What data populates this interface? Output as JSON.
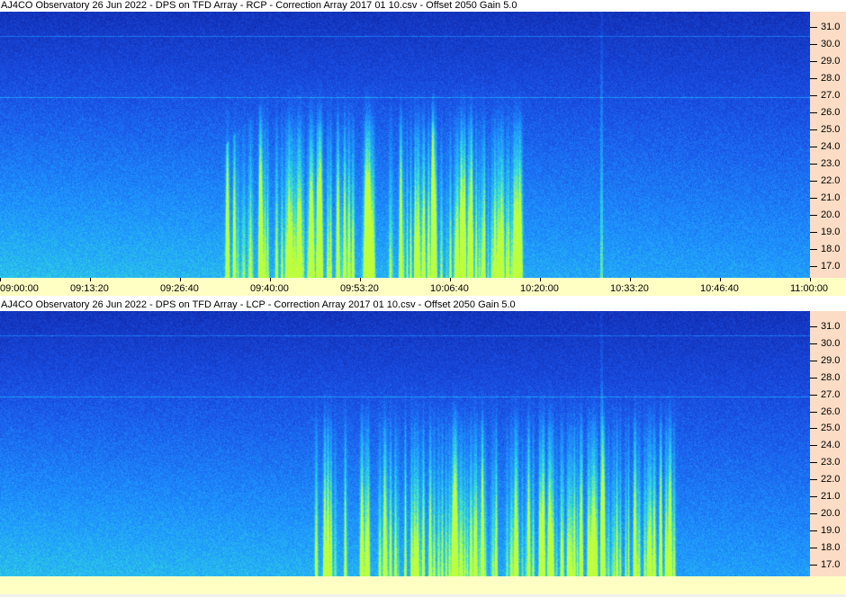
{
  "panels": [
    {
      "title": "AJ4CO Observatory 26  Jun 2022  -  DPS on TFD Array  -  RCP  -  Correction Array 2017 01 10.csv  -  Offset 2050  Gain 5.0",
      "polarization": "RCP",
      "show_time_labels": true
    },
    {
      "title": "AJ4CO Observatory 26  Jun 2022  -  DPS on TFD Array  -  LCP  -  Correction Array 2017 01 10.csv  -  Offset 2050  Gain 5.0",
      "polarization": "LCP",
      "show_time_labels": false
    }
  ],
  "chart_data": {
    "type": "heatmap",
    "x_ticks": [
      "09:00:00",
      "09:13:20",
      "09:26:40",
      "09:40:00",
      "09:53:20",
      "10:06:40",
      "10:20:00",
      "10:33:20",
      "10:46:40",
      "11:00:00"
    ],
    "xlim": [
      "09:00:00",
      "11:00:00"
    ],
    "y_ticks": [
      "31.0",
      "30.0",
      "29.0",
      "28.0",
      "27.0",
      "26.0",
      "25.0",
      "24.0",
      "23.0",
      "22.0",
      "21.0",
      "20.0",
      "19.0",
      "18.0",
      "17.0"
    ],
    "ylim": [
      16.3,
      31.9
    ],
    "colormap": [
      "#1030b0",
      "#1a5cf0",
      "#1ea0ff",
      "#30e0e0",
      "#c0ff40"
    ],
    "axis_position": "right"
  },
  "colors": {
    "yaxis_bg": "#fcdcc4",
    "xaxis_bg": "#ffffc4"
  }
}
